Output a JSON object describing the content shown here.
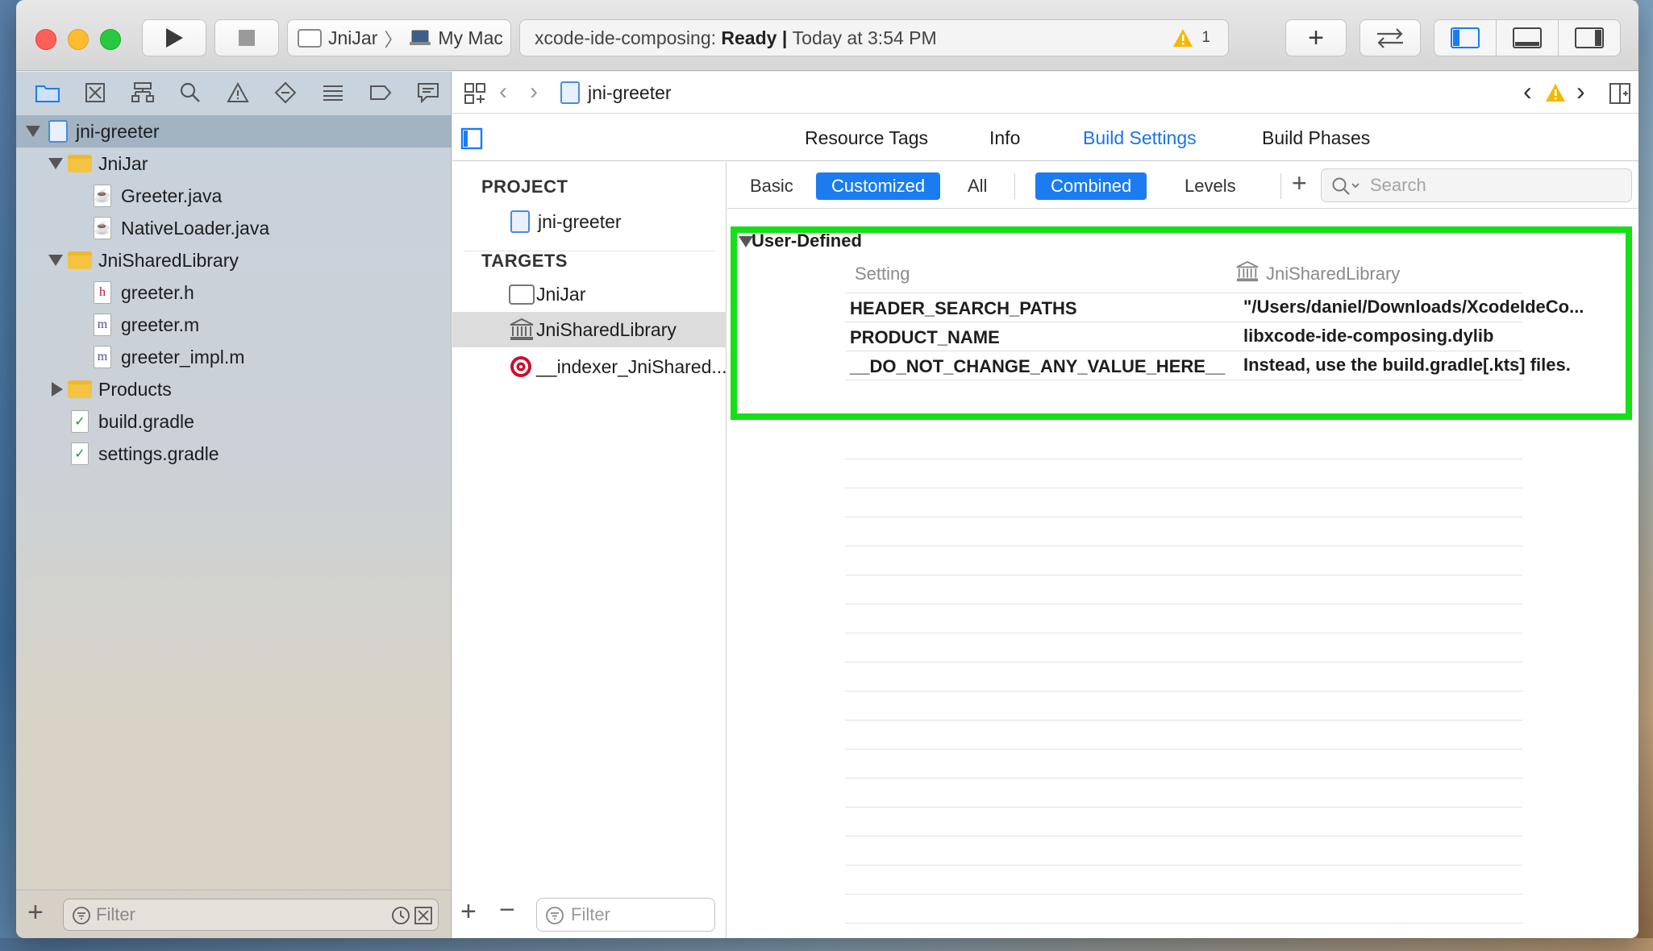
{
  "toolbar": {
    "scheme_target": "JniJar",
    "scheme_device": "My Mac",
    "activity_project": "xcode-ide-composing:",
    "activity_status": "Ready",
    "activity_sep": "|",
    "activity_time": "Today at 3:54 PM",
    "warning_count": "1"
  },
  "navigator": {
    "tree": [
      {
        "label": "jni-greeter",
        "kind": "project",
        "level": 0,
        "expanded": true,
        "selected": true
      },
      {
        "label": "JniJar",
        "kind": "folder",
        "level": 1,
        "expanded": true
      },
      {
        "label": "Greeter.java",
        "kind": "java",
        "level": 2
      },
      {
        "label": "NativeLoader.java",
        "kind": "java",
        "level": 2
      },
      {
        "label": "JniSharedLibrary",
        "kind": "folder",
        "level": 1,
        "expanded": true
      },
      {
        "label": "greeter.h",
        "kind": "h",
        "level": 2
      },
      {
        "label": "greeter.m",
        "kind": "m",
        "level": 2
      },
      {
        "label": "greeter_impl.m",
        "kind": "m",
        "level": 2
      },
      {
        "label": "Products",
        "kind": "folder",
        "level": 1,
        "expanded": false
      },
      {
        "label": "build.gradle",
        "kind": "gradle",
        "level": 1
      },
      {
        "label": "settings.gradle",
        "kind": "gradle",
        "level": 1
      }
    ],
    "filter_placeholder": "Filter"
  },
  "jumpbar": {
    "title": "jni-greeter"
  },
  "editor_tabs": [
    "Resource Tags",
    "Info",
    "Build Settings",
    "Build Phases"
  ],
  "targets_panel": {
    "project_header": "PROJECT",
    "project_item": "jni-greeter",
    "targets_header": "TARGETS",
    "targets": [
      "JniJar",
      "JniSharedLibrary",
      "__indexer_JniShared..."
    ],
    "filter_placeholder": "Filter"
  },
  "filter_bar": {
    "basic": "Basic",
    "customized": "Customized",
    "all": "All",
    "combined": "Combined",
    "levels": "Levels",
    "search_placeholder": "Search"
  },
  "build_settings": {
    "group": "User-Defined",
    "col_setting": "Setting",
    "col_target": "JniSharedLibrary",
    "rows": [
      {
        "key": "HEADER_SEARCH_PATHS",
        "value": "\"/Users/daniel/Downloads/XcodeIdeCo..."
      },
      {
        "key": "PRODUCT_NAME",
        "value": "libxcode-ide-composing.dylib"
      },
      {
        "key": "__DO_NOT_CHANGE_ANY_VALUE_HERE__",
        "value": "Instead, use the build.gradle[.kts] files."
      }
    ]
  },
  "colors": {
    "accent": "#1a7cf0",
    "highlight_box": "#14e015",
    "warning": "#f5b800"
  }
}
